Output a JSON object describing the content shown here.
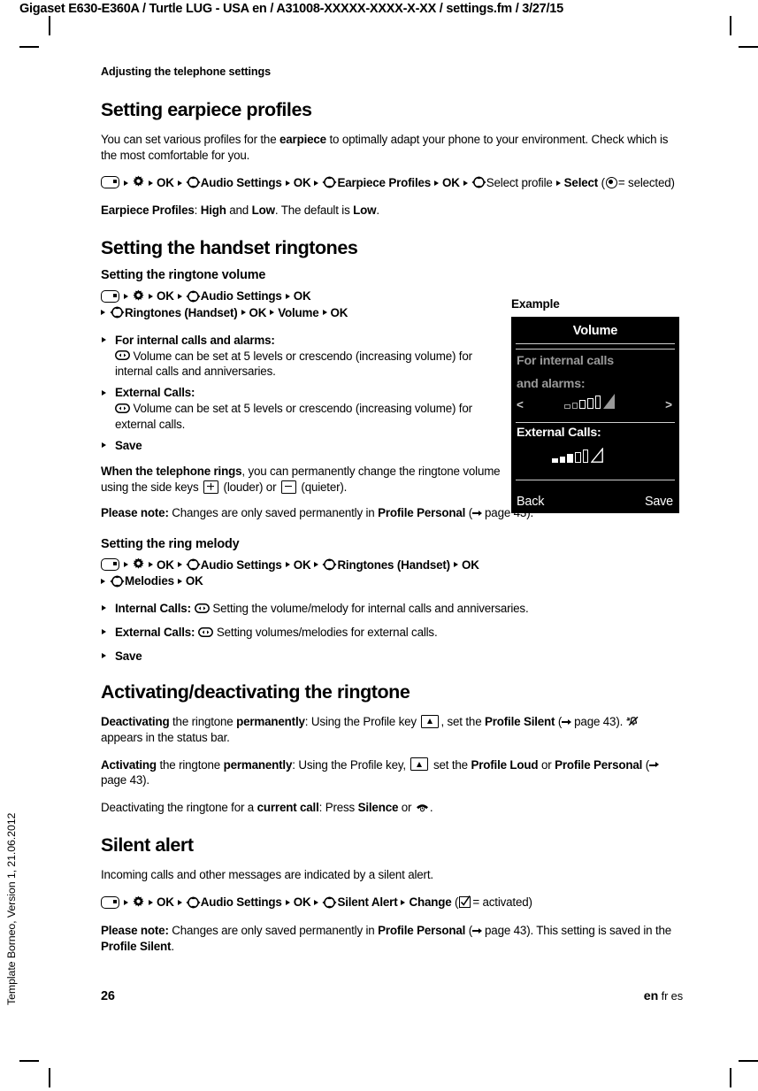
{
  "header": {
    "running_head": "Gigaset E630-E360A / Turtle LUG - USA en / A31008-XXXXX-XXXX-X-XX / settings.fm / 3/27/15"
  },
  "sidenote": "Template Borneo, Version 1, 21.06.2012",
  "chapter": "Adjusting the telephone settings",
  "sections": {
    "earpiece": {
      "title": "Setting earpiece profiles",
      "intro_a": "You can set various profiles for the ",
      "intro_b": "earpiece",
      "intro_c": " to optimally adapt your phone to your environment. Check which is the most comfortable for you.",
      "nav": {
        "ok1": "OK",
        "audio_settings": "Audio Settings",
        "ok2": "OK",
        "earpiece_profiles": "Earpiece Profiles",
        "ok3": "OK",
        "select_profile": "Select profile",
        "select": "Select",
        "selected_eq": "= selected)"
      },
      "profiles_label": "Earpiece Profiles",
      "profiles_a": ": ",
      "profiles_high": "High",
      "profiles_and": " and ",
      "profiles_low": "Low",
      "profiles_b": ". The default is ",
      "profiles_default": "Low",
      "profiles_end": "."
    },
    "ringtones": {
      "title": "Setting the handset ringtones",
      "volume": {
        "subtitle": "Setting the ringtone volume",
        "nav": {
          "ok1": "OK",
          "audio_settings": "Audio Settings",
          "ok2": "OK",
          "ringtones_handset": "Ringtones (Handset)",
          "ok3": "OK",
          "volume": "Volume",
          "ok4": "OK"
        },
        "bullets": [
          {
            "label": "For internal calls and alarms:",
            "text": " Volume can be set at 5 levels or crescendo (increasing volume) for internal calls and anniversaries."
          },
          {
            "label": "External Calls:",
            "text": " Volume can be set at 5 levels or crescendo (increasing volume) for external calls."
          }
        ],
        "save_bullet": "Save",
        "rings_a": "When the telephone rings",
        "rings_b": ", you can permanently change the ringtone volume using the side keys ",
        "rings_c": " (louder) or ",
        "rings_d": " (quieter).",
        "note_label": "Please note:",
        "note_a": " Changes are only saved permanently in ",
        "note_profile": "Profile Personal",
        "note_paren_open": " (",
        "note_page": "page 43",
        "note_paren_close": ")."
      },
      "melody": {
        "subtitle": "Setting the ring melody",
        "nav": {
          "ok1": "OK",
          "audio_settings": "Audio Settings",
          "ok2": "OK",
          "ringtones_handset": "Ringtones (Handset)",
          "ok3": "OK",
          "melodies": "Melodies",
          "ok4": "OK"
        },
        "bullets": [
          {
            "label": "Internal Calls:",
            "text": " Setting the volume/melody for internal calls and anniversaries."
          },
          {
            "label": "External Calls:",
            "text": " Setting volumes/melodies for external calls."
          }
        ],
        "save_bullet": "Save"
      },
      "activation": {
        "title": "Activating/deactivating the ringtone",
        "deact_a": "Deactivating",
        "deact_b": " the ringtone ",
        "deact_c": "permanently",
        "deact_d": ": Using the Profile key ",
        "deact_e": ", set the ",
        "deact_profile": "Profile Silent",
        "deact_paren_open": " (",
        "deact_page": "page 43",
        "deact_paren_close": "). ",
        "deact_tail": " appears in the status bar.",
        "act_a": "Activating",
        "act_b": " the ringtone ",
        "act_c": "permanently",
        "act_d": ": Using the Profile key, ",
        "act_e": " set the ",
        "act_loud": "Profile Loud",
        "act_or": " or ",
        "act_personal": "Profile Personal",
        "act_paren_open": " (",
        "act_page": "page 43",
        "act_paren_close": ").",
        "curr_a": "Deactivating the ringtone for a ",
        "curr_b": "current call",
        "curr_c": ": Press ",
        "curr_silence": "Silence",
        "curr_or": " or ",
        "curr_end": "."
      }
    },
    "silent_alert": {
      "title": "Silent alert",
      "intro": "Incoming calls and other messages are indicated by a silent alert.",
      "nav": {
        "ok1": "OK",
        "audio_settings": "Audio Settings",
        "ok2": "OK",
        "silent_alert": "Silent Alert",
        "change": "Change",
        "activated_eq": "= activated)"
      },
      "note_label": "Please note:",
      "note_a": " Changes are only saved permanently in ",
      "note_profile": "Profile Personal",
      "note_paren_open": " (",
      "note_page": "page 43",
      "note_b": "). This setting is saved in the ",
      "note_silent": "Profile Silent",
      "note_end": "."
    }
  },
  "example": {
    "label": "Example",
    "display": {
      "title": "Volume",
      "line_internal_1": "For internal calls",
      "line_internal_2": "and alarms:",
      "chevron_left": "<",
      "chevron_right": ">",
      "line_external": "External Calls:",
      "softkey_left": "Back",
      "softkey_right": "Save",
      "meter_internal": {
        "open_bars": 5,
        "crescendo": "solid-triangle",
        "level": "crescendo"
      },
      "meter_external": {
        "filled_bars": 3,
        "open_bars": 2,
        "crescendo": "hollow-triangle",
        "level": 3
      }
    }
  },
  "footer": {
    "page_number": "26",
    "lang_current": "en",
    "lang_others": "fr es"
  },
  "colors": {
    "lcd_background": "#000000",
    "lcd_text_active": "#ffffff",
    "lcd_text_dim": "#9a9a9a",
    "page_text": "#000000"
  }
}
